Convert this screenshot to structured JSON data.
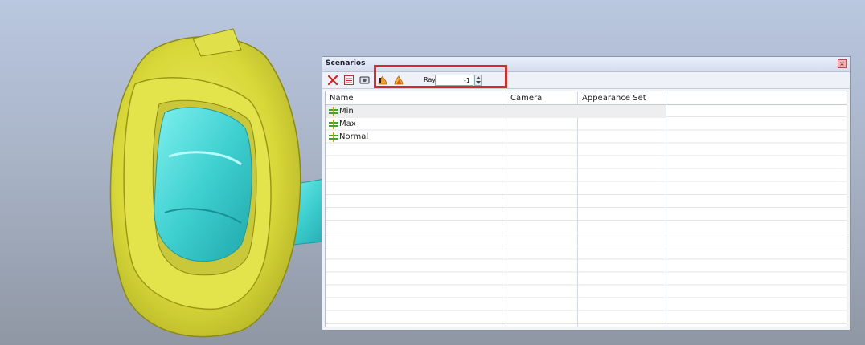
{
  "scene": {
    "description_colors": {
      "housing": "#dcdc3a",
      "inner": "#4fd3d3"
    }
  },
  "panel": {
    "title": "Scenarios",
    "close_glyph": "×",
    "toolbar": {
      "icons": [
        "delete-icon",
        "scenario-list-icon",
        "camera-icon",
        "render-start-icon",
        "render-flame-icon"
      ],
      "rays_label": "Rays:",
      "rays_value": "-1"
    },
    "table": {
      "columns": [
        "Name",
        "Camera",
        "Appearance Set"
      ],
      "rows": [
        {
          "name": "Min",
          "camera": "",
          "appearance": ""
        },
        {
          "name": "Max",
          "camera": "",
          "appearance": ""
        },
        {
          "name": "Normal",
          "camera": "",
          "appearance": ""
        }
      ]
    }
  },
  "colors": {
    "highlight": "#d42a2a",
    "panel_title_bg": "#d4dced"
  }
}
